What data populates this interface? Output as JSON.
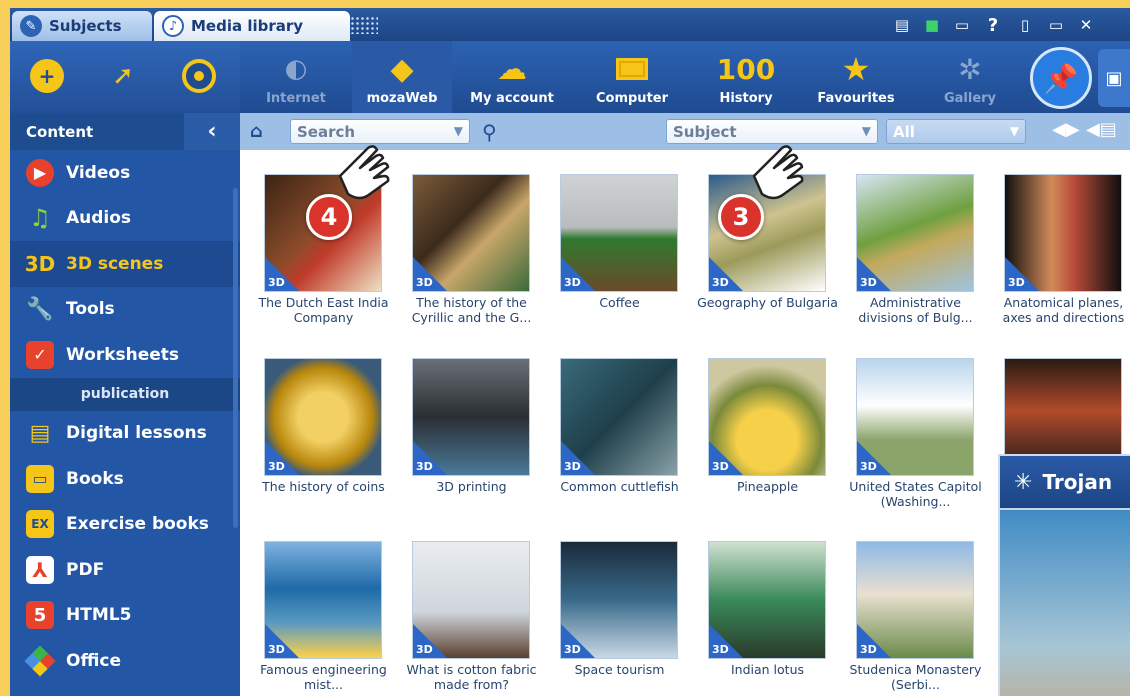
{
  "tabs": [
    {
      "label": "Subjects",
      "icon": "graduation-cap-icon"
    },
    {
      "label": "Media library",
      "icon": "media-library-icon"
    }
  ],
  "toolbar": {
    "quick_buttons": [
      "plus-icon",
      "rocket-icon",
      "target-icon"
    ],
    "nav": [
      {
        "label": "Internet",
        "icon": "globe-cursor-icon",
        "enabled": false
      },
      {
        "label": "mozaWeb",
        "icon": "mozaweb-logo-icon",
        "active": true
      },
      {
        "label": "My account",
        "icon": "cloud-lock-icon"
      },
      {
        "label": "Computer",
        "icon": "monitor-icon"
      },
      {
        "label": "History",
        "icon_text": "100"
      },
      {
        "label": "Favourites",
        "icon": "star-icon"
      },
      {
        "label": "Gallery",
        "icon": "pinwheel-icon",
        "enabled": false
      }
    ]
  },
  "sidebar": {
    "header": "Content",
    "items": [
      {
        "label": "Videos",
        "icon": "play-icon",
        "color": "#e8412c"
      },
      {
        "label": "Audios",
        "icon": "music-note-icon",
        "color": "#8fd33a"
      },
      {
        "label": "3D scenes",
        "icon_text": "3D",
        "color": "#f5c518",
        "active": true
      },
      {
        "label": "Tools",
        "icon": "wrench-icon",
        "color": "#ffffff"
      },
      {
        "label": "Worksheets",
        "icon": "checklist-icon",
        "color": "#e8412c"
      }
    ],
    "section": "publication",
    "items2": [
      {
        "label": "Digital lessons",
        "icon": "lesson-icon",
        "color": "#f5c518"
      },
      {
        "label": "Books",
        "icon": "book-icon",
        "color": "#f5c518"
      },
      {
        "label": "Exercise books",
        "icon": "exercise-book-icon",
        "color": "#f5c518"
      },
      {
        "label": "PDF",
        "icon": "pdf-icon",
        "color": "#e8412c"
      },
      {
        "label": "HTML5",
        "icon": "html5-icon",
        "color": "#e8412c"
      },
      {
        "label": "Office",
        "icon": "office-icon",
        "color": "#4a90e2"
      }
    ]
  },
  "searchbar": {
    "search_placeholder": "Search",
    "subject_placeholder": "Subject",
    "filter_value": "All"
  },
  "items": [
    {
      "caption": "The Dutch East India Company",
      "badge": "3D"
    },
    {
      "caption": "The history of the Cyrillic and the G...",
      "badge": "3D"
    },
    {
      "caption": "Coffee",
      "badge": "3D"
    },
    {
      "caption": "Geography of Bulgaria",
      "badge": "3D"
    },
    {
      "caption": "Administrative divisions of Bulg...",
      "badge": "3D"
    },
    {
      "caption": "Anatomical planes, axes and directions",
      "badge": "3D"
    },
    {
      "caption": "The history of coins",
      "badge": "3D"
    },
    {
      "caption": "3D printing",
      "badge": "3D"
    },
    {
      "caption": "Common cuttlefish",
      "badge": "3D"
    },
    {
      "caption": "Pineapple",
      "badge": "3D"
    },
    {
      "caption": "United States Capitol (Washing...",
      "badge": "3D"
    },
    {
      "caption": "",
      "badge": ""
    },
    {
      "caption": "Famous engineering mist...",
      "badge": "3D"
    },
    {
      "caption": "What is cotton fabric made from?",
      "badge": "3D"
    },
    {
      "caption": "Space tourism",
      "badge": "3D"
    },
    {
      "caption": "Indian lotus",
      "badge": "3D"
    },
    {
      "caption": "Studenica Monastery (Serbi...",
      "badge": "3D"
    }
  ],
  "markers": [
    "4",
    "3"
  ],
  "popup": {
    "title": "Trojan"
  }
}
